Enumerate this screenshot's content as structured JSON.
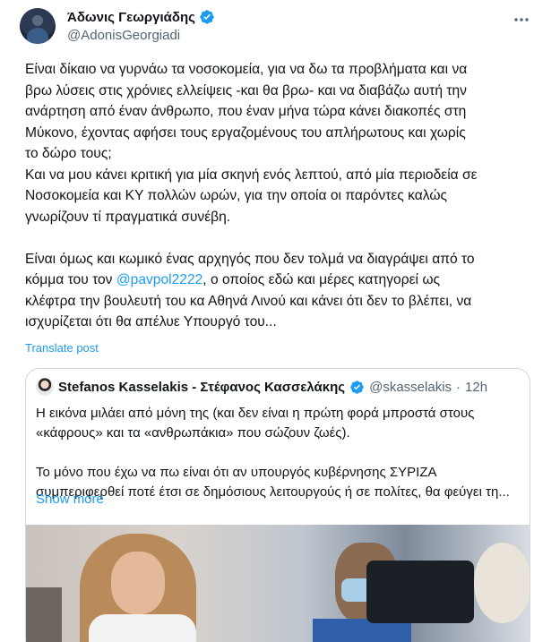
{
  "author": {
    "display_name": "Άδωνις Γεωργιάδης",
    "handle": "@AdonisGeorgiadi"
  },
  "post": {
    "lines_a": [
      "Είναι δίκαιο να γυρνάω τα νοσοκομεία, για να δω τα προβλήματα και να",
      "βρω λύσεις στις χρόνιες ελλείψεις -και θα βρω- και να διαβάζω αυτή την",
      "ανάρτηση από έναν άνθρωπο, που έναν μήνα τώρα κάνει διακοπές στη",
      "Μύκονο, έχοντας αφήσει τους εργαζομένους του απλήρωτους και χωρίς",
      "το δώρο τους;",
      "Και να μου κάνει κριτική για μία σκηνή ενός λεπτού, από μία περιοδεία σε",
      "Νοσοκομεία και ΚΥ πολλών ωρών, για την οποία οι παρόντες καλώς",
      "γνωρίζουν τί πραγματικά συνέβη."
    ],
    "line_b1": "Είναι όμως και κωμικό ένας αρχηγός που δεν τολμά να διαγράψει από το",
    "line_b2_before": "κόμμα του τον ",
    "mention": "@pavpol2222",
    "line_b2_after": ", ο οποίος εδώ και μέρες κατηγορεί ως",
    "line_b3": "κλέφτρα την βουλευτή του κα Αθηνά Λινού και κάνει ότι δεν το βλέπει, να",
    "line_b4": "ισχυρίζεται ότι θα απέλυε Υπουργό του...",
    "translate_label": "Translate post"
  },
  "quote": {
    "display_name": "Stefanos Kasselakis - Στέφανος Κασσελάκης",
    "handle": "@skasselakis",
    "dot": "·",
    "time": "12h",
    "line1": "Η εικόνα μιλάει από μόνη της (και δεν είναι η πρώτη φορά μπροστά στους",
    "line2": "«κάφρους» και τα «ανθρωπάκια» που σώζουν ζωές).",
    "line3": "Το μόνο που έχω να πω είναι ότι αν υπουργός κυβέρνησης ΣΥΡΙΖΑ",
    "line4": "συμπεριφερθεί ποτέ έτσι σε δημόσιους λειτουργούς ή σε πολίτες, θα φεύγει τη...",
    "show_more_label": "Show more"
  },
  "colors": {
    "accent": "#1d9bf0",
    "text": "#0f1419",
    "secondary": "#536471",
    "border": "#cfd9de"
  },
  "icons": [
    "verified-badge-icon",
    "more-options-icon"
  ]
}
